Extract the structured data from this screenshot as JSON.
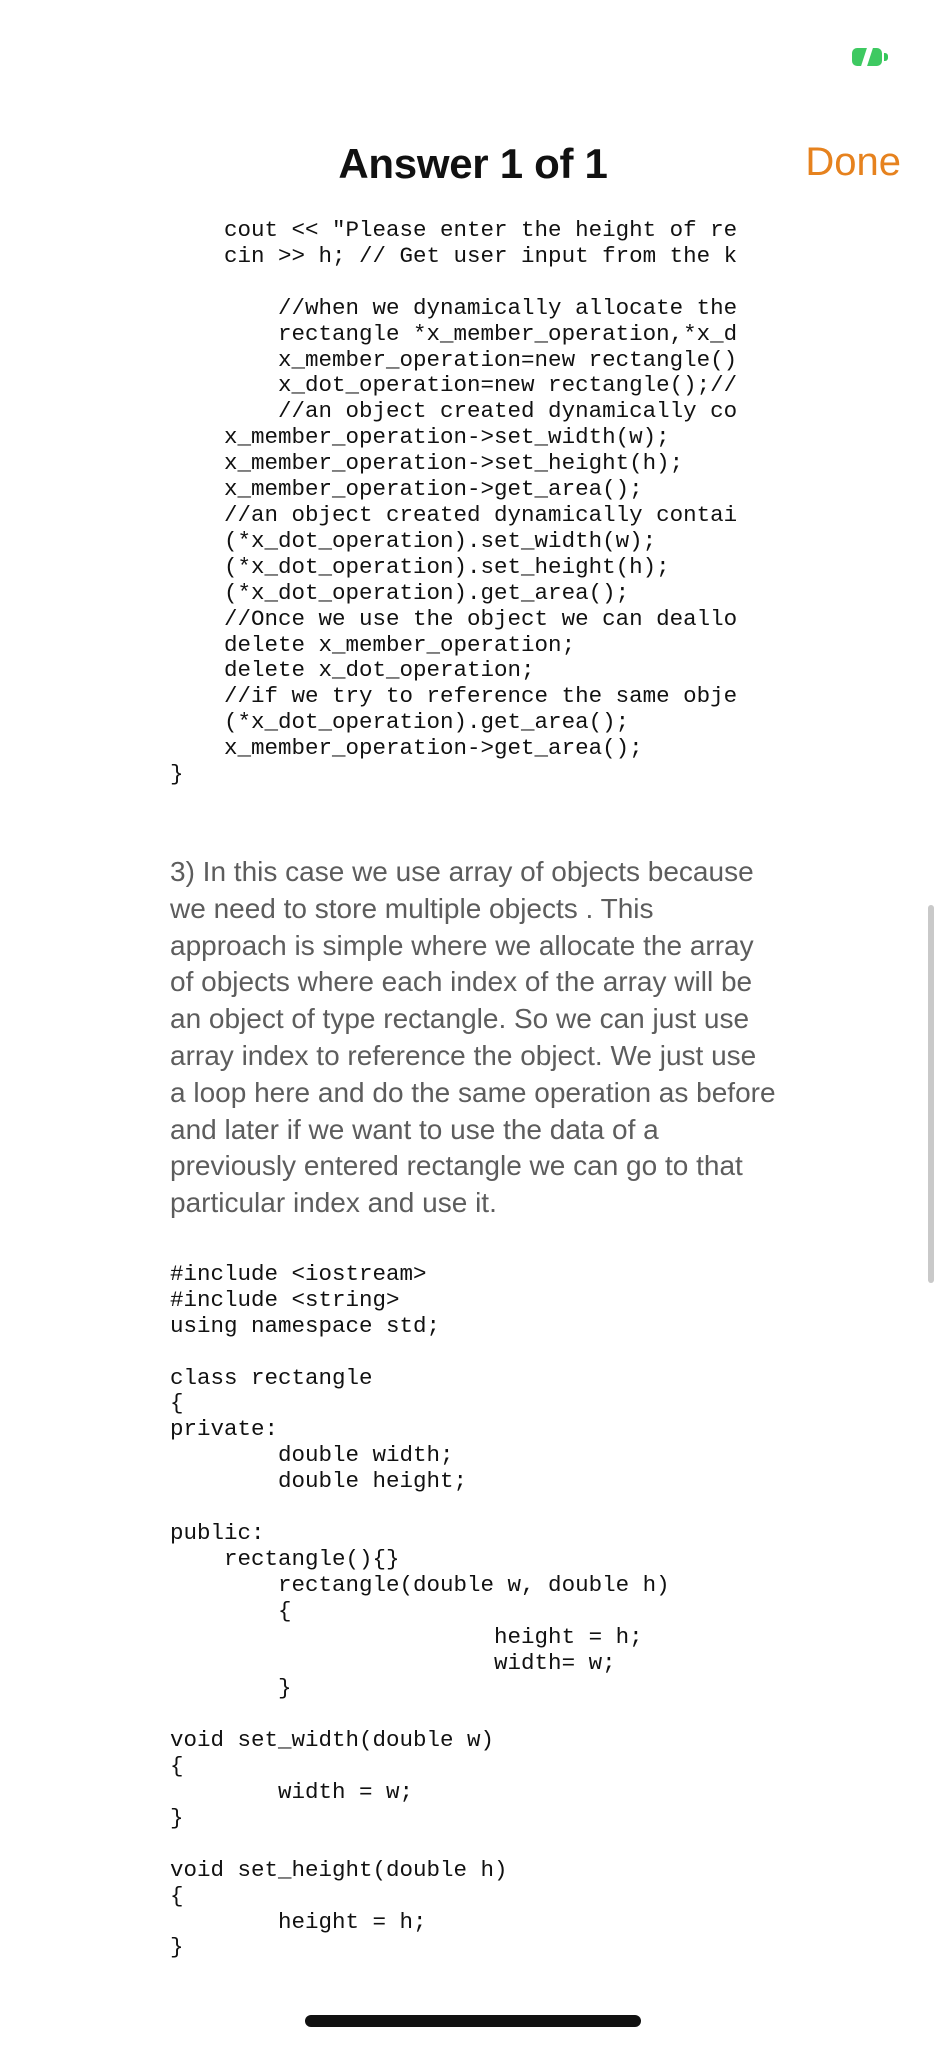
{
  "header": {
    "title": "Answer 1 of 1",
    "done_label": "Done"
  },
  "status": {
    "battery_icon": "battery-charging-icon"
  },
  "content": {
    "code_block_1": "    cout << \"Please enter the height of re\n    cin >> h; // Get user input from the k\n\n        //when we dynamically allocate the\n        rectangle *x_member_operation,*x_d\n        x_member_operation=new rectangle()\n        x_dot_operation=new rectangle();//\n        //an object created dynamically co\n    x_member_operation->set_width(w);\n    x_member_operation->set_height(h);\n    x_member_operation->get_area();\n    //an object created dynamically contai\n    (*x_dot_operation).set_width(w);\n    (*x_dot_operation).set_height(h);\n    (*x_dot_operation).get_area();\n    //Once we use the object we can deallo\n    delete x_member_operation;\n    delete x_dot_operation;\n    //if we try to reference the same obje\n    (*x_dot_operation).get_area();\n    x_member_operation->get_area();\n}",
    "paragraph": "3) In this case we use array of objects because we need to store multiple objects . This approach is simple where we allocate the array of objects where each index of the array will be an object of type rectangle. So we can just use array index to reference the object. We just use a loop here and do the same operation as before and later if we want to use the data of a previously entered rectangle we can go to that particular index and use it.",
    "code_block_2": "#include <iostream>\n#include <string>\nusing namespace std;\n\nclass rectangle\n{\nprivate:\n        double width;\n        double height;\n\npublic:\n    rectangle(){}\n        rectangle(double w, double h)\n        {\n                        height = h;\n                        width= w;\n        }\n\nvoid set_width(double w)\n{\n        width = w;\n}\n\nvoid set_height(double h)\n{\n        height = h;\n}"
  }
}
